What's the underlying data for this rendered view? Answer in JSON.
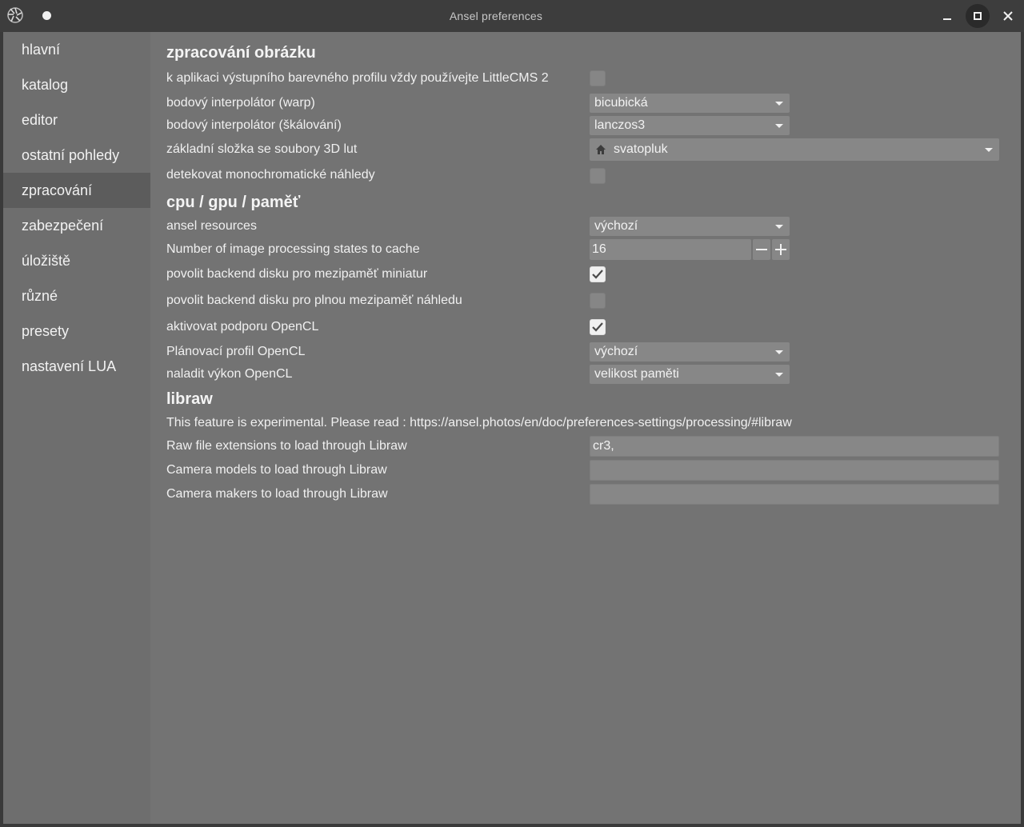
{
  "window": {
    "title": "Ansel preferences"
  },
  "sidebar": {
    "items": [
      {
        "label": "hlavní"
      },
      {
        "label": "katalog"
      },
      {
        "label": "editor"
      },
      {
        "label": "ostatní pohledy"
      },
      {
        "label": "zpracování",
        "active": true
      },
      {
        "label": "zabezpečení"
      },
      {
        "label": "úložiště"
      },
      {
        "label": "různé"
      },
      {
        "label": "presety"
      },
      {
        "label": "nastavení LUA"
      }
    ]
  },
  "image_processing": {
    "heading": "zpracování obrázku",
    "always_lcms_label": "k aplikaci výstupního barevného profilu vždy používejte LittleCMS 2",
    "always_lcms_checked": false,
    "warp_label": "bodový interpolátor (warp)",
    "warp_value": "bicubická",
    "scaling_label": "bodový interpolátor (škálování)",
    "scaling_value": "lanczos3",
    "lut_folder_label": "základní složka se soubory 3D lut",
    "lut_folder_value": "svatopluk",
    "mono_label": "detekovat monochromatické náhledy",
    "mono_checked": false
  },
  "cpu_gpu": {
    "heading": "cpu / gpu / paměť",
    "resources_label": "ansel resources",
    "resources_value": "výchozí",
    "cache_states_label": "Number of image processing states to cache",
    "cache_states_value": "16",
    "disk_thumb_label": "povolit backend disku pro mezipaměť miniatur",
    "disk_thumb_checked": true,
    "disk_full_label": "povolit backend disku pro plnou mezipaměť náhledu",
    "disk_full_checked": false,
    "opencl_label": "aktivovat podporu OpenCL",
    "opencl_checked": true,
    "opencl_profile_label": "Plánovací profil OpenCL",
    "opencl_profile_value": "výchozí",
    "opencl_tune_label": "naladit výkon OpenCL",
    "opencl_tune_value": "velikost paměti"
  },
  "libraw": {
    "heading": "libraw",
    "note": "This feature is experimental. Please read : https://ansel.photos/en/doc/preferences-settings/processing/#libraw",
    "extensions_label": "Raw file extensions to load through Libraw",
    "extensions_value": "cr3,",
    "models_label": "Camera models to load through Libraw",
    "models_value": "",
    "makers_label": "Camera makers to load through Libraw",
    "makers_value": ""
  },
  "icons": {
    "app": "ansel-aperture-icon",
    "menu_dot": "dot-icon",
    "minimize": "minimize-icon",
    "maximize": "maximize-icon",
    "close": "close-icon",
    "dropdown": "chevron-down-icon",
    "home": "home-icon",
    "check": "checkmark-icon",
    "minus": "minus-icon",
    "plus": "plus-icon"
  },
  "colors": {
    "titlebar": "#3d3d3d",
    "sidebar": "#6e6e6e",
    "sidebar_active": "#5c5c5c",
    "content": "#737373",
    "widget": "#878787",
    "text": "#f0f0f0"
  }
}
